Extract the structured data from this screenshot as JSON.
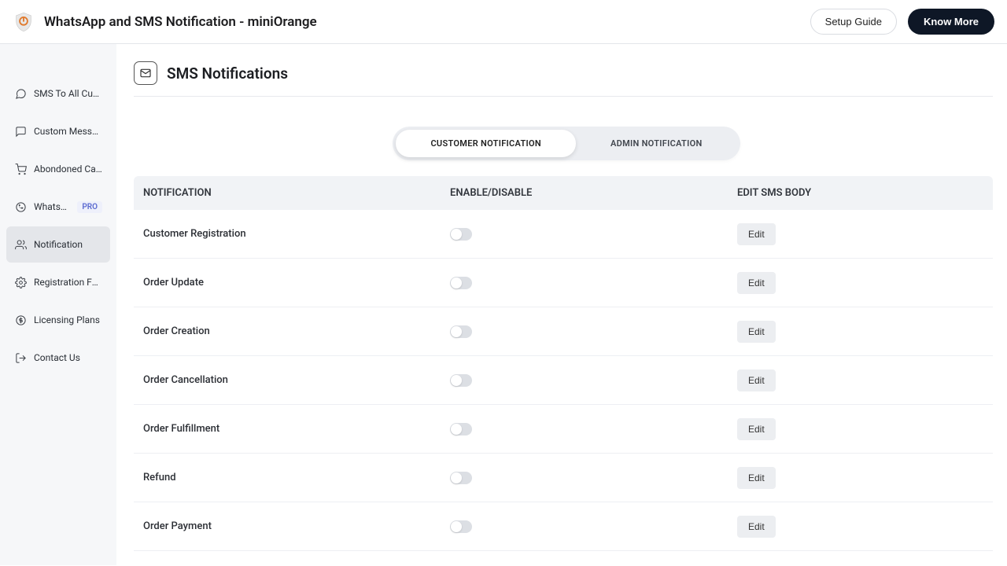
{
  "header": {
    "title": "WhatsApp and SMS Notification - miniOrange",
    "setup_guide": "Setup Guide",
    "know_more": "Know More"
  },
  "sidebar": {
    "items": [
      {
        "label": "SMS To All Customers"
      },
      {
        "label": "Custom Messages"
      },
      {
        "label": "Abondoned Cart Noti..."
      },
      {
        "label": "WhatsApp",
        "badge": "PRO"
      },
      {
        "label": "Notification"
      },
      {
        "label": "Registration Form Set..."
      },
      {
        "label": "Licensing Plans"
      },
      {
        "label": "Contact Us"
      }
    ]
  },
  "page": {
    "title": "SMS Notifications"
  },
  "tabs": {
    "customer": "CUSTOMER NOTIFICATION",
    "admin": "ADMIN NOTIFICATION"
  },
  "table": {
    "head": {
      "notification": "NOTIFICATION",
      "enable": "ENABLE/DISABLE",
      "edit": "EDIT SMS BODY"
    },
    "edit_label": "Edit",
    "rows": [
      {
        "name": "Customer Registration"
      },
      {
        "name": "Order Update"
      },
      {
        "name": "Order Creation"
      },
      {
        "name": "Order Cancellation"
      },
      {
        "name": "Order Fulfillment"
      },
      {
        "name": "Refund"
      },
      {
        "name": "Order Payment"
      }
    ]
  }
}
